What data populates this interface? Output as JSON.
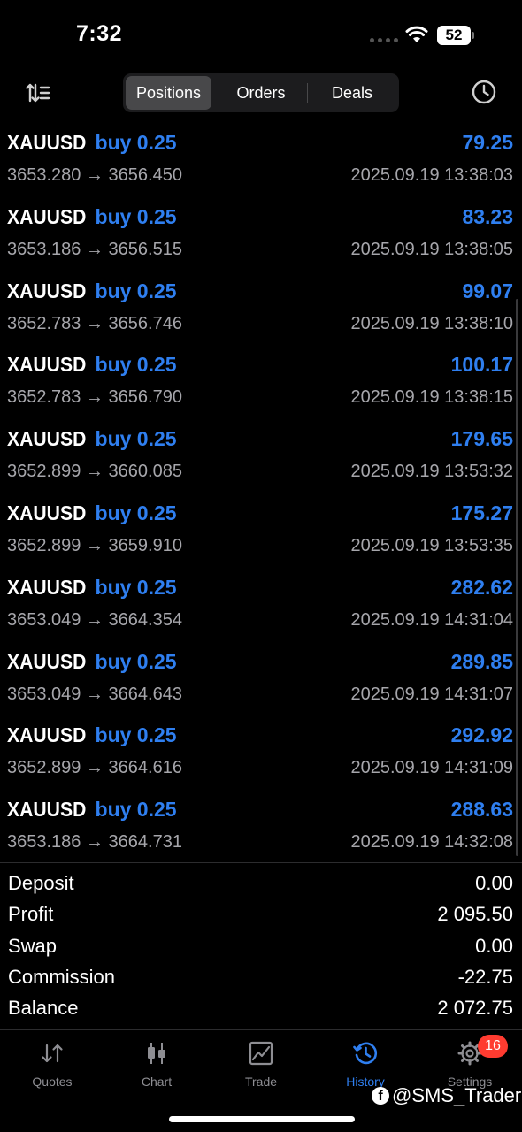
{
  "status_bar": {
    "time": "7:32",
    "battery": "52"
  },
  "toolbar": {
    "segments": [
      {
        "label": "Positions",
        "active": true
      },
      {
        "label": "Orders",
        "active": false
      },
      {
        "label": "Deals",
        "active": false
      }
    ],
    "icons": {
      "left": "sort-icon",
      "right": "clock-history-icon"
    }
  },
  "deals": [
    {
      "symbol": "XAUUSD",
      "side": "buy 0.25",
      "profit": "79.25",
      "open": "3653.280",
      "arrow": "→",
      "close": "3656.450",
      "time": "2025.09.19 13:38:03"
    },
    {
      "symbol": "XAUUSD",
      "side": "buy 0.25",
      "profit": "83.23",
      "open": "3653.186",
      "arrow": "→",
      "close": "3656.515",
      "time": "2025.09.19 13:38:05"
    },
    {
      "symbol": "XAUUSD",
      "side": "buy 0.25",
      "profit": "99.07",
      "open": "3652.783",
      "arrow": "→",
      "close": "3656.746",
      "time": "2025.09.19 13:38:10"
    },
    {
      "symbol": "XAUUSD",
      "side": "buy 0.25",
      "profit": "100.17",
      "open": "3652.783",
      "arrow": "→",
      "close": "3656.790",
      "time": "2025.09.19 13:38:15"
    },
    {
      "symbol": "XAUUSD",
      "side": "buy 0.25",
      "profit": "179.65",
      "open": "3652.899",
      "arrow": "→",
      "close": "3660.085",
      "time": "2025.09.19 13:53:32"
    },
    {
      "symbol": "XAUUSD",
      "side": "buy 0.25",
      "profit": "175.27",
      "open": "3652.899",
      "arrow": "→",
      "close": "3659.910",
      "time": "2025.09.19 13:53:35"
    },
    {
      "symbol": "XAUUSD",
      "side": "buy 0.25",
      "profit": "282.62",
      "open": "3653.049",
      "arrow": "→",
      "close": "3664.354",
      "time": "2025.09.19 14:31:04"
    },
    {
      "symbol": "XAUUSD",
      "side": "buy 0.25",
      "profit": "289.85",
      "open": "3653.049",
      "arrow": "→",
      "close": "3664.643",
      "time": "2025.09.19 14:31:07"
    },
    {
      "symbol": "XAUUSD",
      "side": "buy 0.25",
      "profit": "292.92",
      "open": "3652.899",
      "arrow": "→",
      "close": "3664.616",
      "time": "2025.09.19 14:31:09"
    },
    {
      "symbol": "XAUUSD",
      "side": "buy 0.25",
      "profit": "288.63",
      "open": "3653.186",
      "arrow": "→",
      "close": "3664.731",
      "time": "2025.09.19 14:32:08"
    }
  ],
  "summary": [
    {
      "label": "Deposit",
      "value": "0.00"
    },
    {
      "label": "Profit",
      "value": "2 095.50"
    },
    {
      "label": "Swap",
      "value": "0.00"
    },
    {
      "label": "Commission",
      "value": "-22.75"
    },
    {
      "label": "Balance",
      "value": "2 072.75"
    }
  ],
  "tabbar": {
    "tabs": [
      {
        "label": "Quotes",
        "icon": "quotes-arrows-icon",
        "active": false
      },
      {
        "label": "Chart",
        "icon": "candlestick-icon",
        "active": false
      },
      {
        "label": "Trade",
        "icon": "trade-chart-icon",
        "active": false
      },
      {
        "label": "History",
        "icon": "history-icon",
        "active": true
      },
      {
        "label": "Settings",
        "icon": "gear-icon",
        "active": false
      }
    ],
    "settings_badge": "16"
  },
  "watermark": {
    "text": "@SMS_Trader"
  },
  "colors": {
    "accent": "#2f7ff0",
    "secondary_text": "#a6a6ab",
    "badge": "#ff3b30"
  }
}
